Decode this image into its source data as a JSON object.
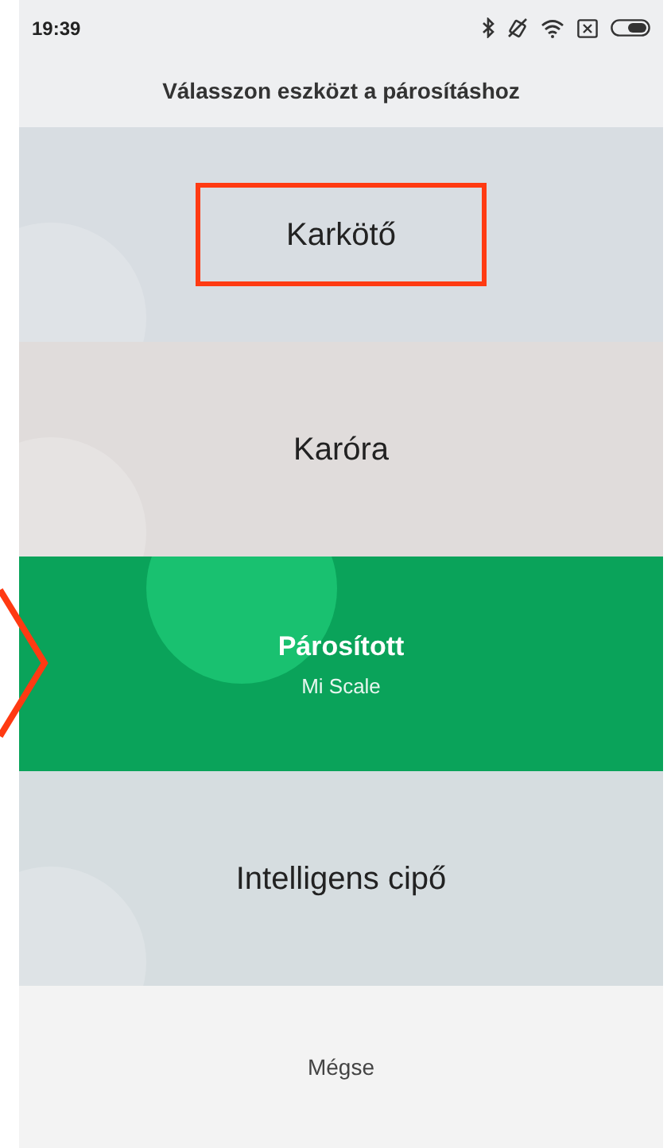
{
  "status_bar": {
    "time": "19:39"
  },
  "title": "Válasszon eszközt a párosításhoz",
  "devices": [
    {
      "name": "Karkötő",
      "selected": false,
      "framed": true,
      "pointed": false
    },
    {
      "name": "Karóra",
      "selected": false,
      "framed": false,
      "pointed": false
    },
    {
      "name": "Párosított",
      "subtitle": "Mi Scale",
      "selected": true,
      "framed": false,
      "pointed": true
    },
    {
      "name": "Intelligens cipő",
      "selected": false,
      "framed": false,
      "pointed": false
    }
  ],
  "cancel_button": "Mégse"
}
